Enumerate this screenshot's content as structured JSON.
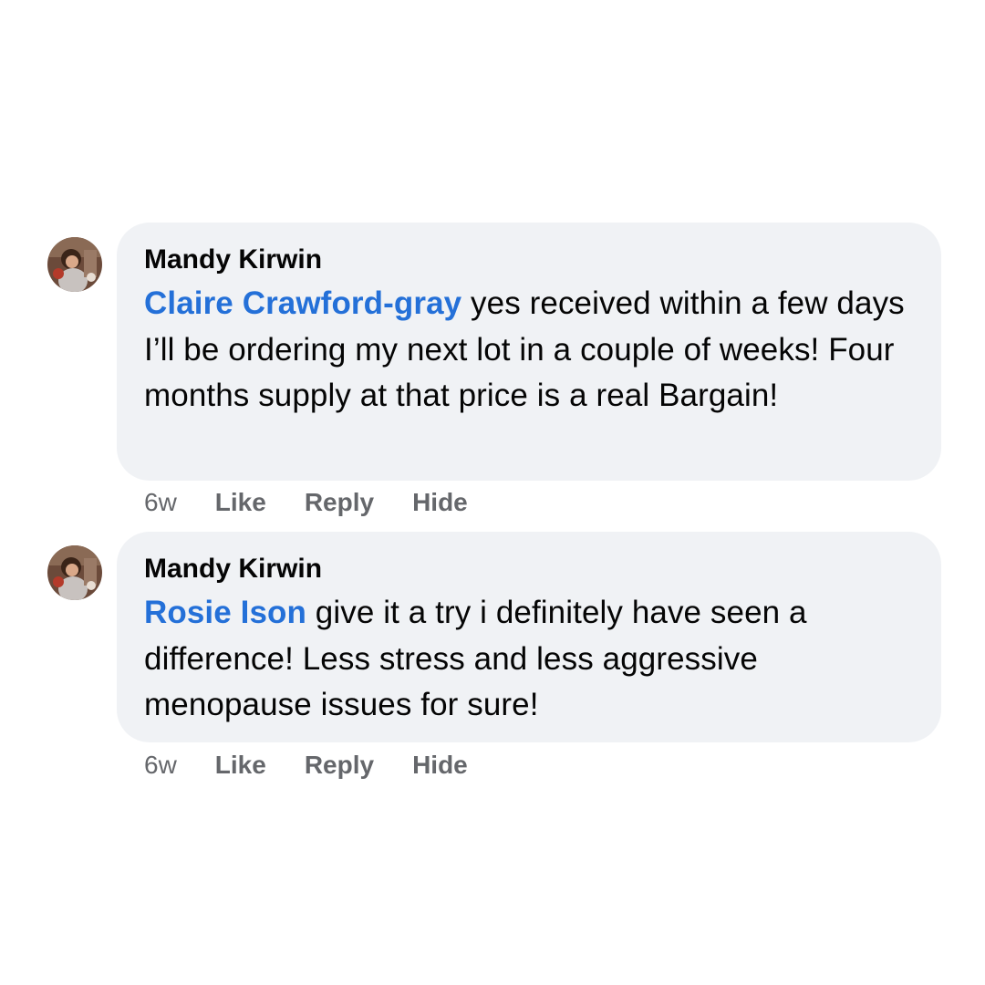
{
  "comments": [
    {
      "author": "Mandy Kirwin",
      "mention": "Claire Crawford-gray",
      "text": " yes received within a few days I’ll be ordering my next lot in a couple of weeks! Four months supply at that price is a real Bargain!",
      "time": "6w",
      "actions": {
        "like": "Like",
        "reply": "Reply",
        "hide": "Hide"
      }
    },
    {
      "author": "Mandy Kirwin",
      "mention": "Rosie Ison",
      "text": " give it a try i definitely have seen a difference! Less stress and less aggressive menopause issues for sure!",
      "time": "6w",
      "actions": {
        "like": "Like",
        "reply": "Reply",
        "hide": "Hide"
      }
    }
  ],
  "colors": {
    "bubble": "#f0f2f5",
    "mention": "#2470d8",
    "meta": "#65676b"
  }
}
